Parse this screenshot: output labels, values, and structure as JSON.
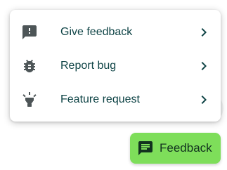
{
  "menu": {
    "items": [
      {
        "label": "Give feedback",
        "icon": "feedback-icon"
      },
      {
        "label": "Report bug",
        "icon": "bug-icon"
      },
      {
        "label": "Feature request",
        "icon": "lightbulb-icon"
      }
    ]
  },
  "fab": {
    "label": "Feedback",
    "icon": "feedback-icon"
  },
  "colors": {
    "text": "#0f4446",
    "icon": "#4d5557",
    "fab_background": "#7ede5a",
    "fab_text": "#12321f"
  }
}
